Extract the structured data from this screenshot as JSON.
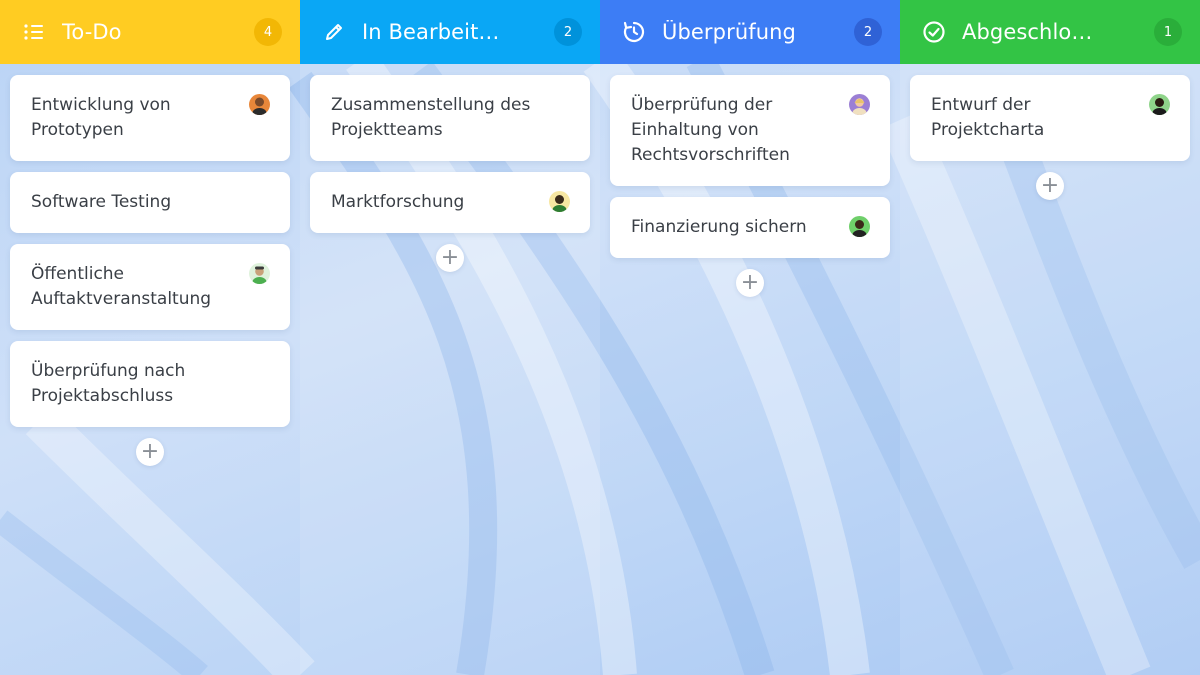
{
  "colors": {
    "todo": "#FFCC22",
    "todo_badge": "#F2B705",
    "in_progress": "#0AA7F5",
    "in_progress_badge": "#0092DB",
    "review": "#3D7DF5",
    "review_badge": "#2F62D6",
    "done": "#33C445",
    "done_badge": "#2AAE3A"
  },
  "columns": [
    {
      "title": "To-Do",
      "count": "4",
      "icon": "list-icon",
      "cards": [
        {
          "title": "Entwicklung von Prototypen",
          "avatar": "avatar-orange"
        },
        {
          "title": "Software Testing",
          "avatar": ""
        },
        {
          "title": "Öffentliche Auftaktveranstaltung",
          "avatar": "avatar-green"
        },
        {
          "title": "Überprüfung nach Projektabschluss",
          "avatar": ""
        }
      ]
    },
    {
      "title": "In Bearbeit…",
      "count": "2",
      "icon": "pencil-icon",
      "cards": [
        {
          "title": "Zusammenstellung des Projektteams",
          "avatar": ""
        },
        {
          "title": "Marktforschung",
          "avatar": "avatar-yellow"
        }
      ]
    },
    {
      "title": "Überprüfung",
      "count": "2",
      "icon": "history-icon",
      "cards": [
        {
          "title": "Überprüfung der Einhaltung von Rechtsvorschriften",
          "avatar": "avatar-purple"
        },
        {
          "title": "Finanzierung sichern",
          "avatar": "avatar-lime"
        }
      ]
    },
    {
      "title": "Abgeschlo…",
      "count": "1",
      "icon": "check-circle-icon",
      "cards": [
        {
          "title": "Entwurf der Projektcharta",
          "avatar": "avatar-dark"
        }
      ]
    }
  ],
  "add_label": "+"
}
